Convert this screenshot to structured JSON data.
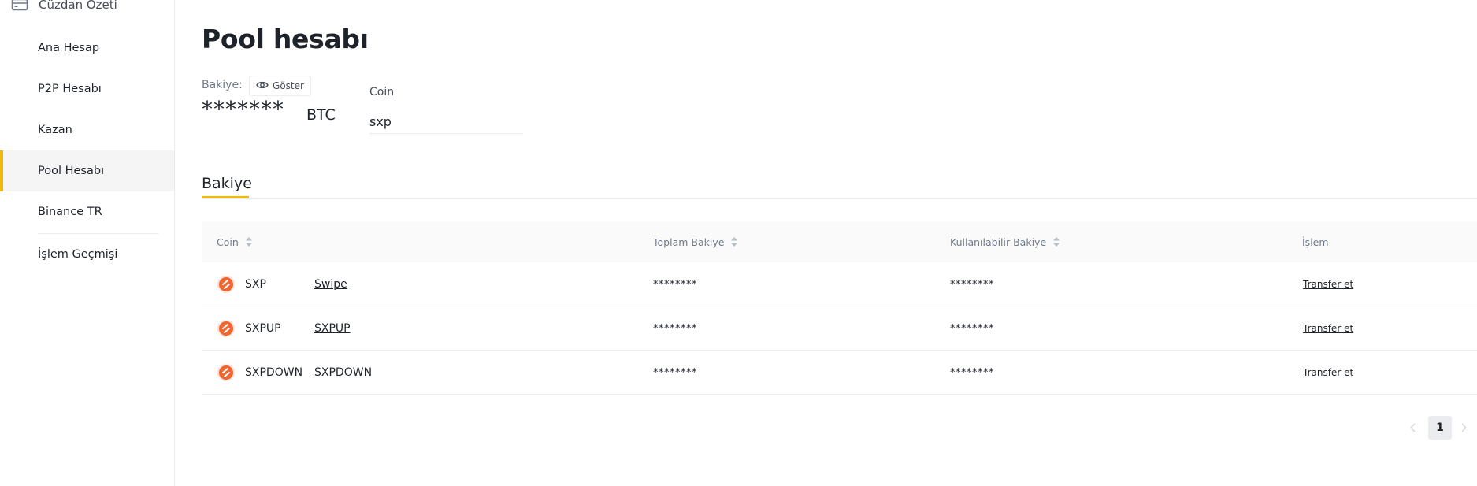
{
  "sidebar": {
    "top_label": "Cüzdan Özeti",
    "items": [
      {
        "label": "Ana Hesap",
        "active": false
      },
      {
        "label": "P2P Hesabı",
        "active": false
      },
      {
        "label": "Kazan",
        "active": false
      },
      {
        "label": "Pool Hesabı",
        "active": true
      },
      {
        "label": "Binance TR",
        "active": false
      },
      {
        "label": "İşlem Geçmişi",
        "active": false
      }
    ]
  },
  "page": {
    "title": "Pool hesabı",
    "balance_label": "Bakiye:",
    "show_button": "Göster",
    "balance_value": "*******",
    "balance_unit": "BTC",
    "coin_filter_label": "Coin",
    "coin_filter_value": "sxp"
  },
  "tabs": [
    {
      "label": "Bakiye",
      "active": true
    }
  ],
  "table": {
    "headers": {
      "coin": "Coin",
      "total": "Toplam Bakiye",
      "available": "Kullanılabilir Bakiye",
      "action": "İşlem"
    },
    "rows": [
      {
        "symbol": "SXP",
        "name": "Swipe",
        "total": "********",
        "available": "********",
        "action": "Transfer et"
      },
      {
        "symbol": "SXPUP",
        "name": "SXPUP",
        "total": "********",
        "available": "********",
        "action": "Transfer et"
      },
      {
        "symbol": "SXPDOWN",
        "name": "SXPDOWN",
        "total": "********",
        "available": "********",
        "action": "Transfer et"
      }
    ]
  },
  "pagination": {
    "current_page": "1"
  },
  "colors": {
    "accent": "#f0b90b",
    "coin_icon": "#f0662e"
  }
}
